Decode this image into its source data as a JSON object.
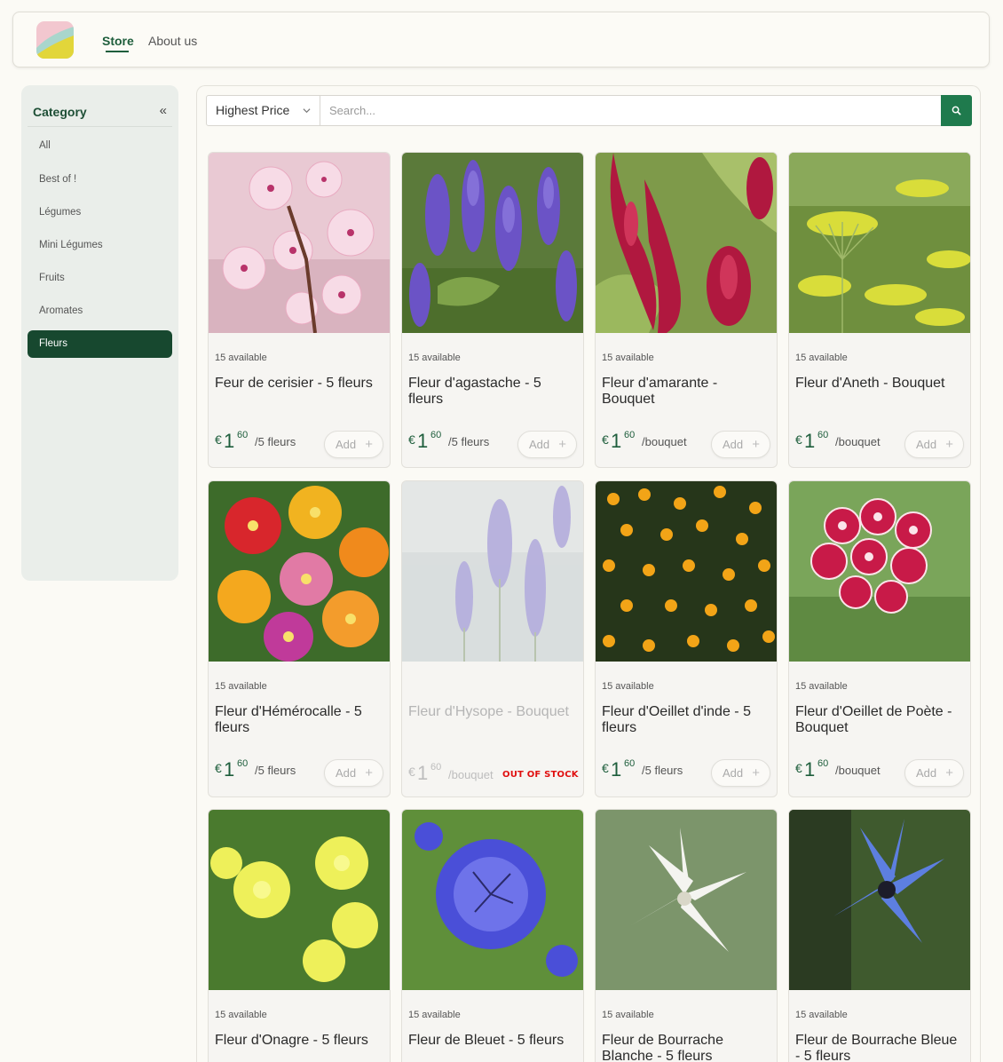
{
  "nav": {
    "store_label": "Store",
    "about_label": "About us"
  },
  "sidebar": {
    "title": "Category",
    "collapse_glyph": "«",
    "items": [
      {
        "label": "All"
      },
      {
        "label": "Best of !"
      },
      {
        "label": "Légumes"
      },
      {
        "label": "Mini Légumes"
      },
      {
        "label": "Fruits"
      },
      {
        "label": "Aromates"
      },
      {
        "label": "Fleurs",
        "active": true
      }
    ]
  },
  "toolbar": {
    "sort_value": "Highest Price",
    "search_placeholder": "Search..."
  },
  "colors": {
    "brand_green": "#1e5e3c",
    "active_category": "#17482f",
    "search_button": "#1f7a4d",
    "out_of_stock": "#e01010"
  },
  "products": [
    {
      "availability": "15 available",
      "title": "Feur de cerisier - 5 fleurs",
      "currency": "€",
      "price_int": "1",
      "price_dec": "60",
      "unit": "/5 fleurs",
      "add_label": "Add",
      "image": "pink-cherry-blossom"
    },
    {
      "availability": "15 available",
      "title": "Fleur d'agastache - 5 fleurs",
      "currency": "€",
      "price_int": "1",
      "price_dec": "60",
      "unit": "/5 fleurs",
      "add_label": "Add",
      "image": "purple-agastache"
    },
    {
      "availability": "15 available",
      "title": "Fleur d'amarante - Bouquet",
      "currency": "€",
      "price_int": "1",
      "price_dec": "60",
      "unit": "/bouquet",
      "add_label": "Add",
      "image": "red-amaranth"
    },
    {
      "availability": "15 available",
      "title": "Fleur d'Aneth - Bouquet",
      "currency": "€",
      "price_int": "1",
      "price_dec": "60",
      "unit": "/bouquet",
      "add_label": "Add",
      "image": "yellow-dill"
    },
    {
      "availability": "15 available",
      "title": "Fleur d'Hémérocalle - 5 fleurs",
      "currency": "€",
      "price_int": "1",
      "price_dec": "60",
      "unit": "/5 fleurs",
      "add_label": "Add",
      "image": "daylilies"
    },
    {
      "availability": "",
      "title": "Fleur d'Hysope - Bouquet",
      "currency": "€",
      "price_int": "1",
      "price_dec": "60",
      "unit": "/bouquet",
      "add_label": "",
      "out_of_stock": "OUT OF STOCK",
      "image": "blue-hyssop"
    },
    {
      "availability": "15 available",
      "title": "Fleur d'Oeillet d'inde - 5 fleurs",
      "currency": "€",
      "price_int": "1",
      "price_dec": "60",
      "unit": "/5 fleurs",
      "add_label": "Add",
      "image": "orange-marigold"
    },
    {
      "availability": "15 available",
      "title": "Fleur d'Oeillet de Poète - Bouquet",
      "currency": "€",
      "price_int": "1",
      "price_dec": "60",
      "unit": "/bouquet",
      "add_label": "Add",
      "image": "sweet-william"
    },
    {
      "availability": "15 available",
      "title": "Fleur d'Onagre - 5 fleurs",
      "image": "evening-primrose"
    },
    {
      "availability": "15 available",
      "title": "Fleur de Bleuet - 5 fleurs",
      "image": "cornflower"
    },
    {
      "availability": "15 available",
      "title": "Fleur de Bourrache Blanche - 5 fleurs",
      "image": "white-borage"
    },
    {
      "availability": "15 available",
      "title": "Fleur de Bourrache Bleue - 5 fleurs",
      "image": "blue-borage"
    }
  ]
}
